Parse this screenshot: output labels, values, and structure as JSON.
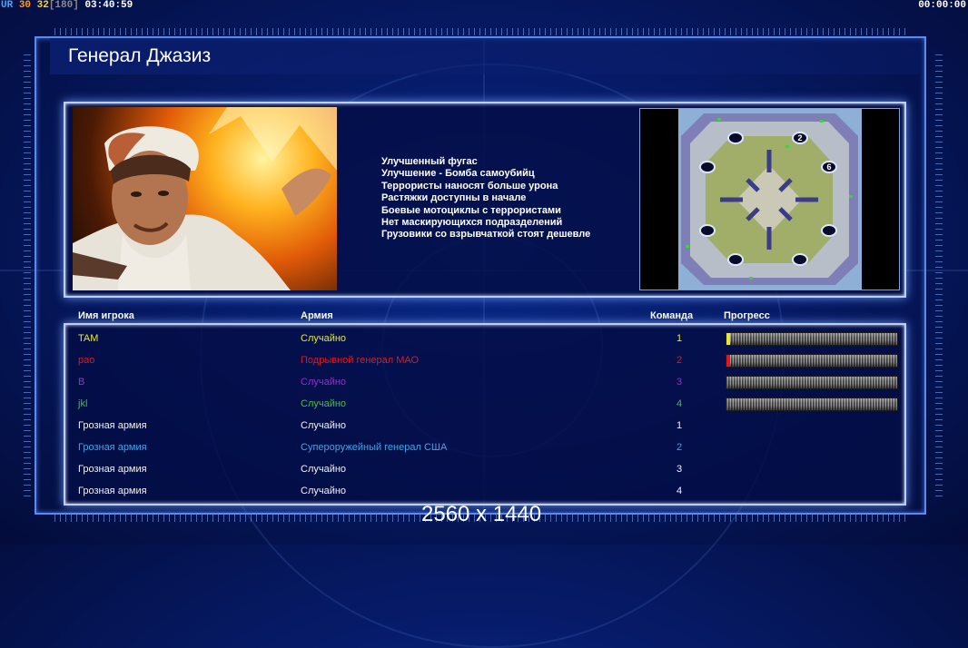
{
  "hud": {
    "left_prefix": "UR",
    "fps_current": "30",
    "fps_avg": "32",
    "fps_limit": "[180]",
    "clock": "03:40:59",
    "timer": "00:00:00"
  },
  "screen": {
    "title": "Генерал Джазиз",
    "features": [
      "Улучшенный фугас",
      "Улучшение - Бомба самоубийц",
      "Террористы наносят больше урона",
      "Растяжки доступны в начале",
      "Боевые мотоциклы с террористами",
      "Нет маскирующихся подразделений",
      "Грузовики со взрывчаткой стоят дешевле"
    ],
    "map_markers": [
      "2",
      "6"
    ],
    "columns": {
      "player": "Имя игрока",
      "army": "Армия",
      "team": "Команда",
      "progress": "Прогресс"
    },
    "players": [
      {
        "name": "TAM",
        "army": "Случайно",
        "team": "1",
        "color": "#e7e72d",
        "progress": 0.02
      },
      {
        "name": "pao",
        "army": "Подрывной генерал МАО",
        "team": "2",
        "color": "#e01818",
        "progress": 0.02
      },
      {
        "name": "B",
        "army": "Случайно",
        "team": "3",
        "color": "#9b2ccf",
        "progress": 0.0
      },
      {
        "name": "jkl",
        "army": "Случайно",
        "team": "4",
        "color": "#44c23a",
        "progress": 0.0
      },
      {
        "name": "Грозная армия",
        "army": "Случайно",
        "team": "1",
        "color": "#f2f2f2",
        "progress": null
      },
      {
        "name": "Грозная армия",
        "army": "Супероружейный генерал США",
        "team": "2",
        "color": "#3fa5e8",
        "progress": null
      },
      {
        "name": "Грозная армия",
        "army": "Случайно",
        "team": "3",
        "color": "#f2f2f2",
        "progress": null
      },
      {
        "name": "Грозная армия",
        "army": "Случайно",
        "team": "4",
        "color": "#f2f2f2",
        "progress": null
      }
    ],
    "resolution_label": "2560 x 1440"
  },
  "colors": {
    "accent": "#5c8ae6",
    "fps_yellow": "#ffd21e",
    "fps_orange": "#ff9c1e",
    "hud_blue": "#4aa3ff"
  }
}
